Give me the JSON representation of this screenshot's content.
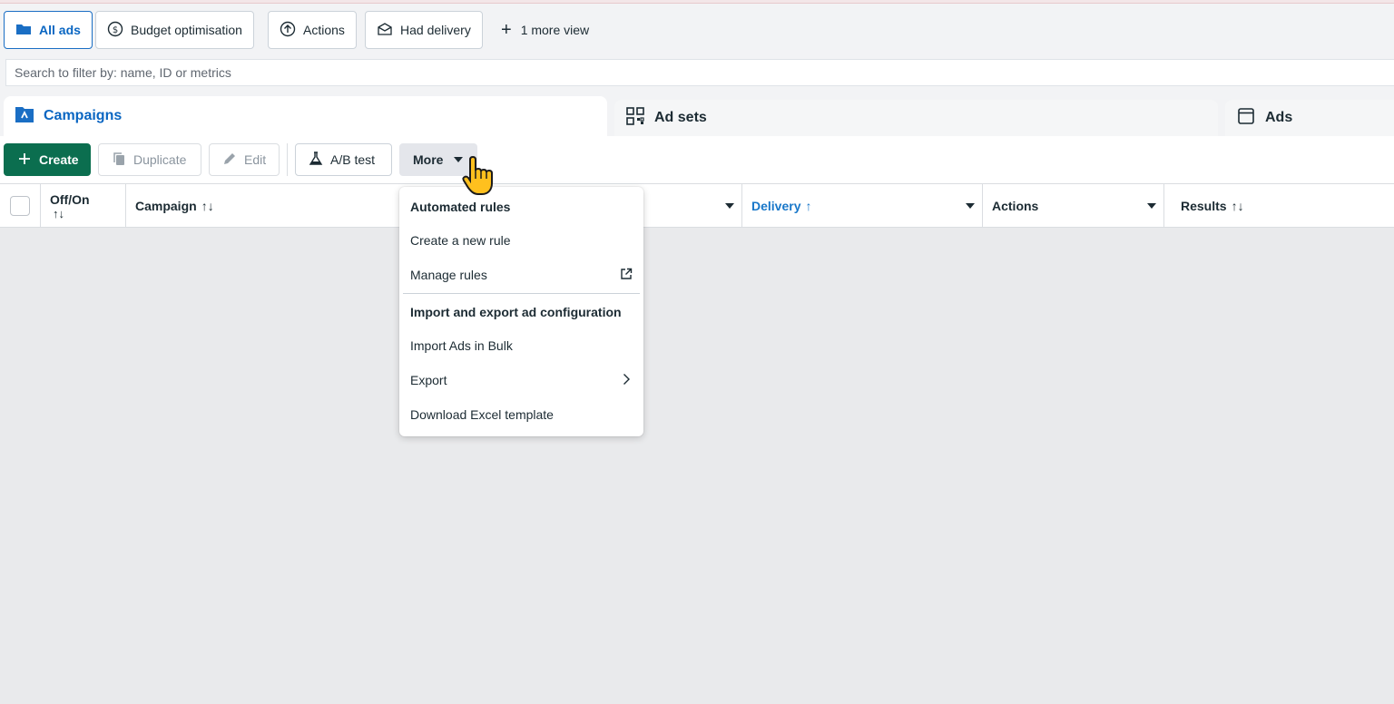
{
  "views": {
    "tabs": [
      {
        "label": "All ads",
        "icon": "folder-icon",
        "active": true
      },
      {
        "label": "Budget optimisation",
        "icon": "dollar-circle-icon"
      },
      {
        "label": "Actions",
        "icon": "arrow-up-circle-icon"
      },
      {
        "label": "Had delivery",
        "icon": "envelope-icon"
      }
    ],
    "more_label": "1 more view"
  },
  "search": {
    "placeholder": "Search to filter by: name, ID or metrics",
    "value": ""
  },
  "levels": [
    {
      "label": "Campaigns",
      "icon": "campaign-folder-icon",
      "active": true
    },
    {
      "label": "Ad sets",
      "icon": "grid-icon"
    },
    {
      "label": "Ads",
      "icon": "ad-window-icon"
    }
  ],
  "toolbar": {
    "create": "Create",
    "duplicate": "Duplicate",
    "edit": "Edit",
    "ab_test": "A/B test",
    "more": "More"
  },
  "columns": {
    "off_on": "Off/On",
    "campaign": "Campaign",
    "delivery": "Delivery",
    "actions": "Actions",
    "results": "Results"
  },
  "sort_icons": {
    "both": "↑↓",
    "up": "↑"
  },
  "more_menu": {
    "automated_heading": "Automated rules",
    "create_rule": "Create a new rule",
    "manage_rules": "Manage rules",
    "import_export_heading": "Import and export ad configuration",
    "import_bulk": "Import Ads in Bulk",
    "export": "Export",
    "download_template": "Download Excel template"
  },
  "colors": {
    "accent": "#0a66c2",
    "create_green": "#0b6e4f",
    "background": "#e9eaec"
  }
}
